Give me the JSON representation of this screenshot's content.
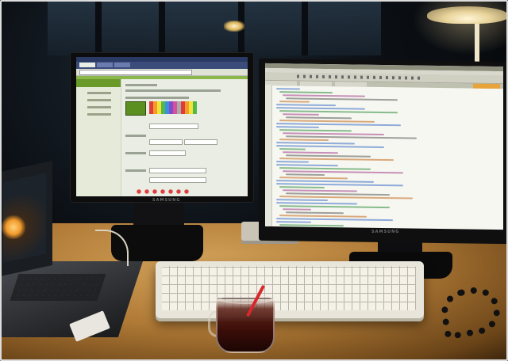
{
  "scene": {
    "left_monitor_brand": "SAMSUNG",
    "right_monitor_brand": "SAMSUNG"
  },
  "colors": {
    "desk": "#c08a45",
    "left_screen_bg": "#e9ede3",
    "left_screen_accent": "#6a9a2a",
    "right_screen_bg": "#f6f7f0",
    "straw": "#d8282c",
    "lamp": "#efe6c7"
  },
  "icons": [
    "lamp-icon",
    "mug-icon",
    "keyboard-icon",
    "laptop-icon",
    "monitor-icon",
    "phone-cord-icon"
  ]
}
